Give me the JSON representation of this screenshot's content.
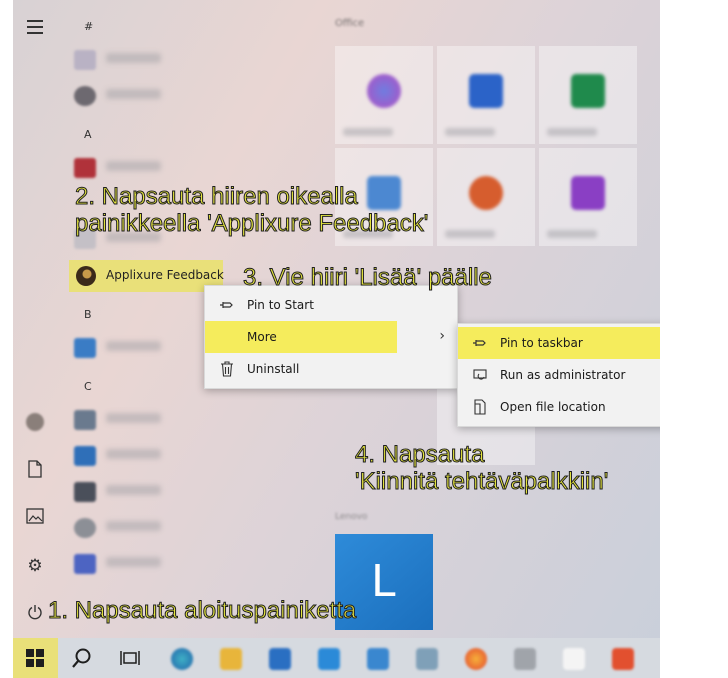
{
  "app_list": {
    "letters": [
      "#",
      "A",
      "B",
      "C"
    ],
    "highlighted_app": "Applixure Feedback"
  },
  "tiles": {
    "header": "Office",
    "lenovo_label": "Lenovo"
  },
  "context_menu": {
    "items": [
      {
        "label": "Pin to Start",
        "icon": "pin-icon"
      },
      {
        "label": "More",
        "icon": "",
        "has_submenu": true
      },
      {
        "label": "Uninstall",
        "icon": "trash-icon"
      }
    ]
  },
  "submenu": {
    "items": [
      {
        "label": "Pin to taskbar",
        "icon": "pin-icon"
      },
      {
        "label": "Run as administrator",
        "icon": "shield-icon"
      },
      {
        "label": "Open file location",
        "icon": "folder-icon"
      }
    ]
  },
  "callouts": {
    "step1": "1. Napsauta aloituspainiketta",
    "step2_line1": "2. Napsauta hiiren oikealla",
    "step2_line2": "painikkeella 'Applixure Feedback'",
    "step3": "3. Vie hiiri 'Lisää' päälle",
    "step4_line1": "4. Napsauta",
    "step4_line2": "'Kiinnitä tehtäväpalkkiin'"
  },
  "colors": {
    "highlight": "#f5ec5c",
    "callout_text": "#e5e53f"
  }
}
